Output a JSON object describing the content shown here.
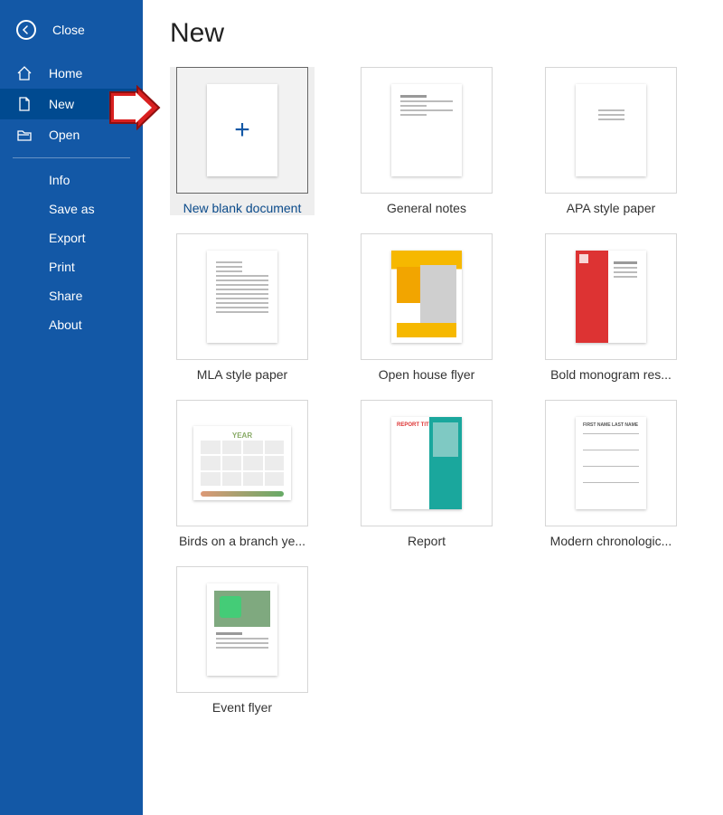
{
  "sidebar": {
    "close_label": "Close",
    "nav": [
      {
        "id": "home",
        "label": "Home",
        "icon": "home-icon",
        "selected": false
      },
      {
        "id": "new",
        "label": "New",
        "icon": "new-doc-icon",
        "selected": true
      },
      {
        "id": "open",
        "label": "Open",
        "icon": "open-folder-icon",
        "selected": false
      }
    ],
    "subnav": [
      {
        "id": "info",
        "label": "Info"
      },
      {
        "id": "saveas",
        "label": "Save as"
      },
      {
        "id": "export",
        "label": "Export"
      },
      {
        "id": "print",
        "label": "Print"
      },
      {
        "id": "share",
        "label": "Share"
      },
      {
        "id": "about",
        "label": "About"
      }
    ]
  },
  "main": {
    "heading": "New",
    "templates": [
      {
        "id": "blank",
        "label": "New blank document",
        "highlight": true,
        "kind": "blank"
      },
      {
        "id": "general",
        "label": "General notes",
        "highlight": false,
        "kind": "notes"
      },
      {
        "id": "apa",
        "label": "APA style paper",
        "highlight": false,
        "kind": "paper"
      },
      {
        "id": "mla",
        "label": "MLA style paper",
        "highlight": false,
        "kind": "text"
      },
      {
        "id": "openhouse",
        "label": "Open house flyer",
        "highlight": false,
        "kind": "ohf"
      },
      {
        "id": "boldresume",
        "label": "Bold monogram res...",
        "highlight": false,
        "kind": "boldresume"
      },
      {
        "id": "birds",
        "label": "Birds on a branch ye...",
        "highlight": false,
        "kind": "calendar"
      },
      {
        "id": "report",
        "label": "Report",
        "highlight": false,
        "kind": "report"
      },
      {
        "id": "chronres",
        "label": "Modern chronologic...",
        "highlight": false,
        "kind": "chronresume"
      },
      {
        "id": "eventflyer",
        "label": "Event flyer",
        "highlight": false,
        "kind": "eventflyer"
      }
    ],
    "calendar_title": "YEAR",
    "report_title": "REPORT TITLE",
    "chron_name": "FIRST NAME LAST NAME"
  },
  "colors": {
    "sidebar_bg": "#1358a6",
    "sidebar_selected": "#004a90",
    "accent": "#0a4a8a",
    "arrow": "#d92020"
  }
}
